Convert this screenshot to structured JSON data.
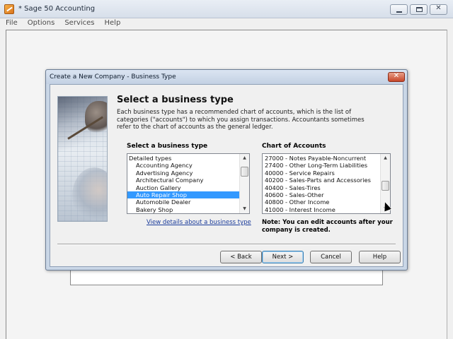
{
  "app": {
    "title": "* Sage 50 Accounting",
    "menu": [
      "File",
      "Options",
      "Services",
      "Help"
    ],
    "window_controls": {
      "minimize": "minimize-icon",
      "maximize": "maximize-icon",
      "close": "close-icon"
    }
  },
  "dialog": {
    "title": "Create a New Company - Business Type",
    "heading": "Select a business type",
    "description": "Each business type has a recommended chart of accounts, which is the list of categories (\"accounts\") to which you assign transactions. Accountants sometimes refer to the chart of accounts as the general ledger.",
    "business_type": {
      "label": "Select a business type",
      "items": [
        {
          "text": "Detailed types",
          "indent": false,
          "selected": false
        },
        {
          "text": "Accounting Agency",
          "indent": true,
          "selected": false
        },
        {
          "text": "Advertising Agency",
          "indent": true,
          "selected": false
        },
        {
          "text": "Architectural Company",
          "indent": true,
          "selected": false
        },
        {
          "text": "Auction Gallery",
          "indent": true,
          "selected": false
        },
        {
          "text": "Auto Repair Shop",
          "indent": true,
          "selected": true
        },
        {
          "text": "Automobile Dealer",
          "indent": true,
          "selected": false
        },
        {
          "text": "Bakery Shop",
          "indent": true,
          "selected": false
        }
      ],
      "details_link": "View details about a business type"
    },
    "chart_of_accounts": {
      "label": "Chart of Accounts",
      "items": [
        "27000 - Notes Payable-Noncurrent",
        "27400 - Other Long-Term Liabilities",
        "40000 - Service Repairs",
        "40200 - Sales-Parts and Accessories",
        "40400 - Sales-Tires",
        "40600 - Sales-Other",
        "40800 - Other Income",
        "41000 - Interest Income"
      ],
      "note": "Note: You can edit accounts after your company is created."
    },
    "buttons": {
      "back": "< Back",
      "next": "Next >",
      "cancel": "Cancel",
      "help": "Help"
    }
  }
}
